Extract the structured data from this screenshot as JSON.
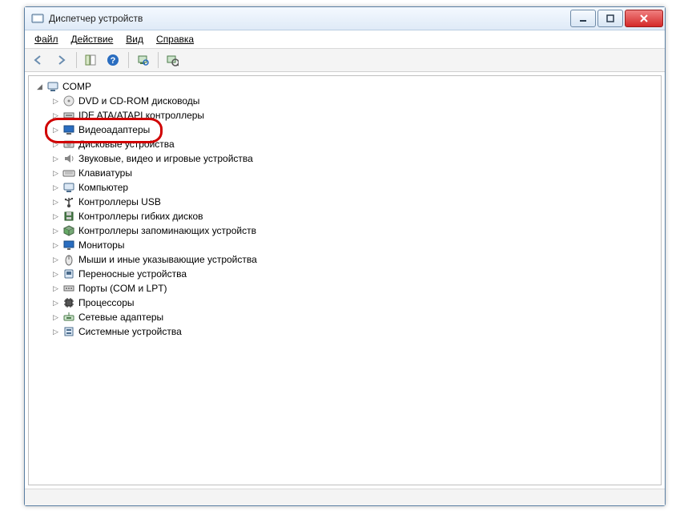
{
  "window": {
    "title": "Диспетчер устройств"
  },
  "menu": {
    "file": "Файл",
    "action": "Действие",
    "view": "Вид",
    "help": "Справка"
  },
  "tree": {
    "root": "COMP",
    "items": [
      {
        "icon": "disc",
        "label": "DVD и CD-ROM дисководы"
      },
      {
        "icon": "ide",
        "label": "IDE ATA/ATAPI контроллеры"
      },
      {
        "icon": "display",
        "label": "Видеоадаптеры",
        "highlighted": true
      },
      {
        "icon": "drive",
        "label": "Дисковые устройства"
      },
      {
        "icon": "sound",
        "label": "Звуковые, видео и игровые устройства"
      },
      {
        "icon": "keyboard",
        "label": "Клавиатуры"
      },
      {
        "icon": "computer",
        "label": "Компьютер"
      },
      {
        "icon": "usb",
        "label": "Контроллеры USB"
      },
      {
        "icon": "floppy",
        "label": "Контроллеры гибких дисков"
      },
      {
        "icon": "storage",
        "label": "Контроллеры запоминающих устройств"
      },
      {
        "icon": "monitor",
        "label": "Мониторы"
      },
      {
        "icon": "mouse",
        "label": "Мыши и иные указывающие устройства"
      },
      {
        "icon": "portable",
        "label": "Переносные устройства"
      },
      {
        "icon": "port",
        "label": "Порты (COM и LPT)"
      },
      {
        "icon": "cpu",
        "label": "Процессоры"
      },
      {
        "icon": "network",
        "label": "Сетевые адаптеры"
      },
      {
        "icon": "system",
        "label": "Системные устройства"
      }
    ]
  }
}
